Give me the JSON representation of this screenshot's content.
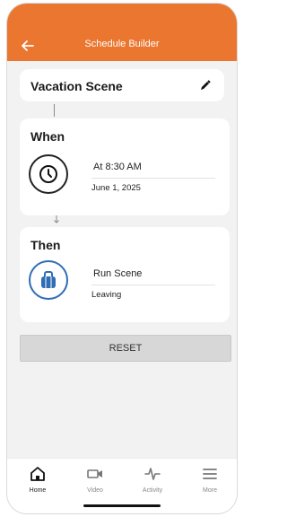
{
  "header": {
    "title": "Schedule Builder",
    "back_icon": "back-arrow-icon"
  },
  "scene": {
    "name": "Vacation Scene",
    "edit_icon": "pencil-icon"
  },
  "when": {
    "title": "When",
    "icon": "clock-icon",
    "time_label": "At 8:30 AM",
    "date_label": "June 1, 2025"
  },
  "then": {
    "title": "Then",
    "icon": "bag-icon",
    "action_label": "Run Scene",
    "scene_label": "Leaving"
  },
  "reset_label": "RESET",
  "tabs": [
    {
      "label": "Home",
      "icon": "home-icon",
      "active": true
    },
    {
      "label": "Video",
      "icon": "video-camera-icon",
      "active": false
    },
    {
      "label": "Activity",
      "icon": "activity-pulse-icon",
      "active": false
    },
    {
      "label": "More",
      "icon": "menu-icon",
      "active": false
    }
  ],
  "colors": {
    "accent": "#ea7630",
    "blue": "#2f6db5"
  }
}
